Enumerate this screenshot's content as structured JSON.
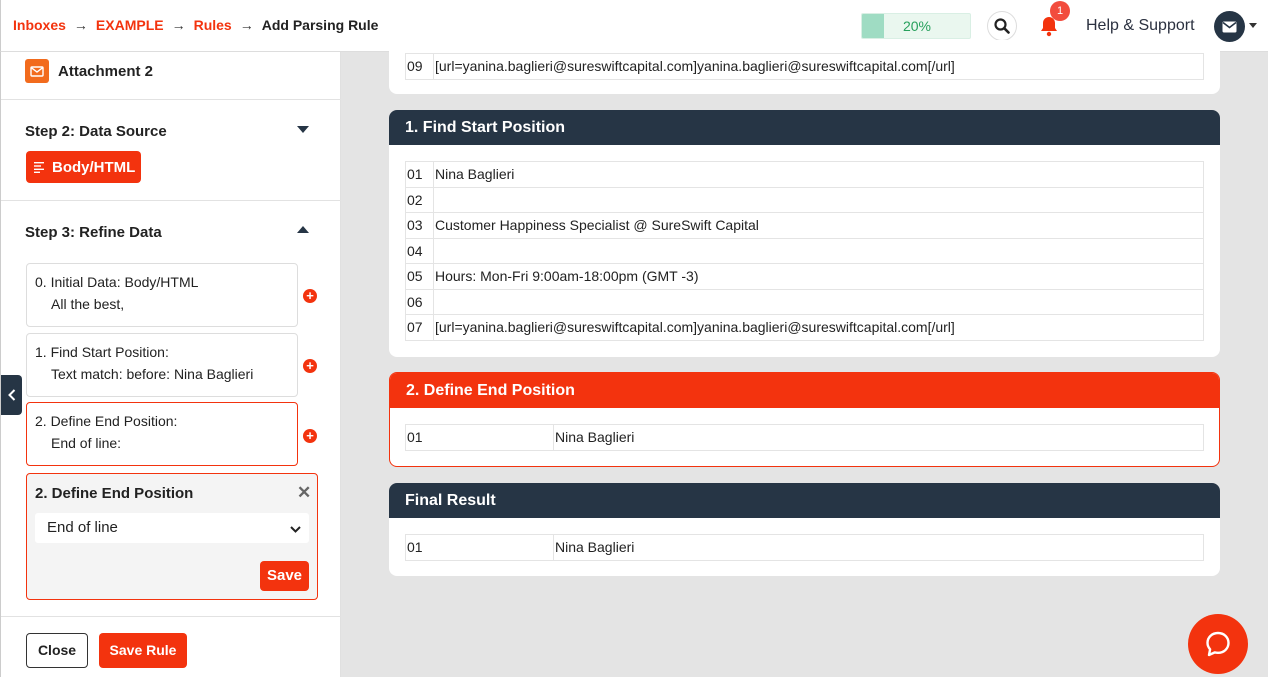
{
  "breadcrumb": {
    "items": [
      "Inboxes",
      "EXAMPLE",
      "Rules"
    ],
    "current": "Add Parsing Rule"
  },
  "header": {
    "progress_value": 0.2,
    "progress_label": "20%",
    "notification_count": "1",
    "help_label": "Help & Support"
  },
  "sidebar": {
    "attachment_label": "Attachment 2",
    "step2_title": "Step 2: Data Source",
    "data_source_button": "Body/HTML",
    "step3_title": "Step 3: Refine Data",
    "steps": [
      {
        "line1": "0. Initial Data: Body/HTML",
        "line2": "All the best,"
      },
      {
        "line1": "1. Find Start Position:",
        "line2": "Text match: before: Nina Baglieri"
      },
      {
        "line1": "2. Define End Position:",
        "line2": "End of line:"
      }
    ],
    "editor": {
      "title": "2. Define End Position",
      "close_glyph": "✕",
      "selected_option": "End of line",
      "save_label": "Save"
    },
    "close_button": "Close",
    "save_rule_button": "Save Rule"
  },
  "main": {
    "top_fragment": {
      "rows": [
        {
          "num": "09",
          "text": "[url=yanina.baglieri@sureswiftcapital.com]yanina.baglieri@sureswiftcapital.com[/url]"
        }
      ]
    },
    "find_start": {
      "title": "1. Find Start Position",
      "rows": [
        {
          "num": "01",
          "text": "Nina Baglieri"
        },
        {
          "num": "02",
          "text": ""
        },
        {
          "num": "03",
          "text": "Customer Happiness Specialist @ SureSwift Capital"
        },
        {
          "num": "04",
          "text": ""
        },
        {
          "num": "05",
          "text": "Hours: Mon-Fri 9:00am-18:00pm (GMT -3)"
        },
        {
          "num": "06",
          "text": ""
        },
        {
          "num": "07",
          "text": "[url=yanina.baglieri@sureswiftcapital.com]yanina.baglieri@sureswiftcapital.com[/url]"
        }
      ]
    },
    "define_end": {
      "title": "2. Define End Position",
      "rows": [
        {
          "num": "01",
          "text": "Nina Baglieri"
        }
      ]
    },
    "final_result": {
      "title": "Final Result",
      "rows": [
        {
          "num": "01",
          "text": "Nina Baglieri"
        }
      ]
    }
  },
  "colors": {
    "accent": "#f3330e",
    "dark": "#263545",
    "progress_fill": "#9fdcc3",
    "progress_text": "#27a05c"
  }
}
